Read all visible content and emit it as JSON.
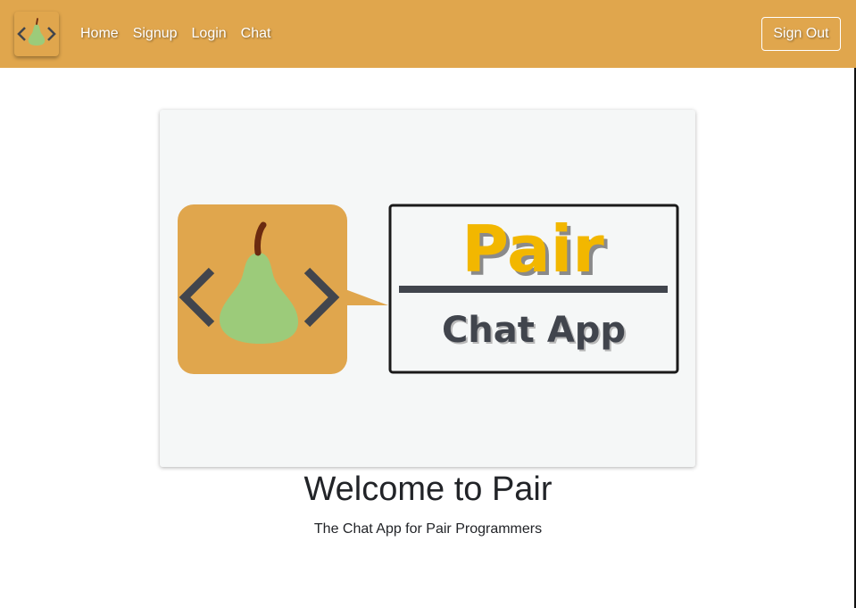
{
  "nav": {
    "links": [
      "Home",
      "Signup",
      "Login",
      "Chat"
    ],
    "sign_out_label": "Sign Out"
  },
  "hero": {
    "logo_word": "Pair",
    "logo_caption": "Chat App"
  },
  "main": {
    "title": "Welcome to Pair",
    "subtitle": "The Chat App for Pair Programmers"
  },
  "colors": {
    "accent": "#e0a64d",
    "pear": "#9ccb7a",
    "logo_yellow": "#f2b700",
    "dark": "#41454d"
  }
}
